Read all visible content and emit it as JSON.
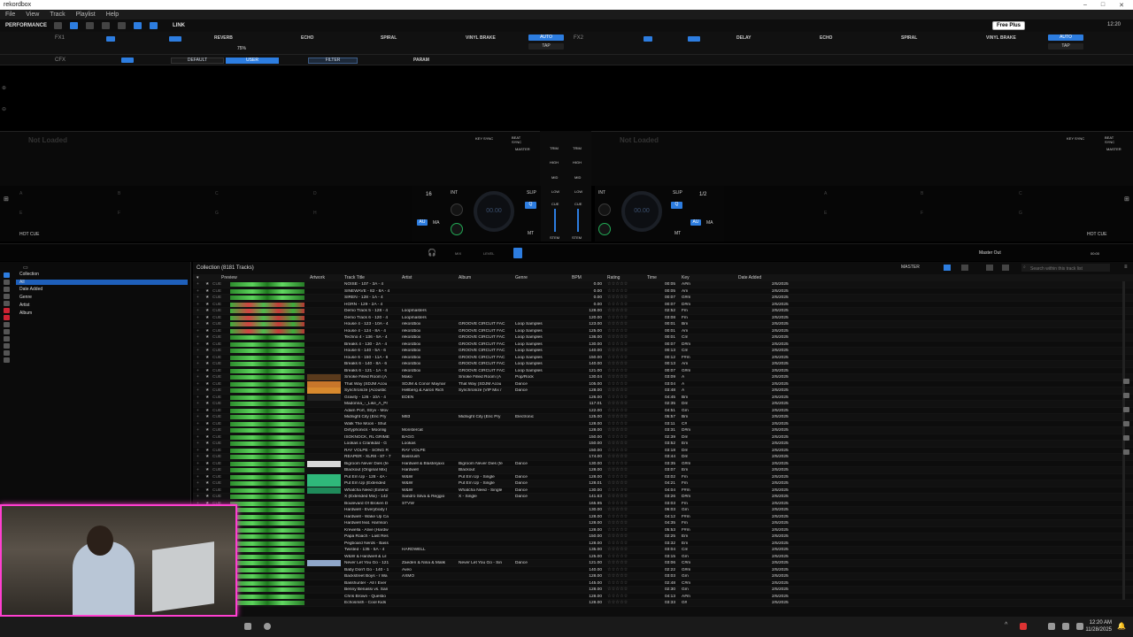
{
  "window": {
    "title": "rekordbox"
  },
  "menu": [
    "File",
    "View",
    "Track",
    "Playlist",
    "Help"
  ],
  "toolbar": {
    "mode": "PERFORMANCE",
    "link": "LINK",
    "free_plus": "Free Plus",
    "clock": "12:20"
  },
  "fx1": {
    "label": "FX1",
    "effects": [
      "REVERB",
      "ECHO",
      "SPIRAL",
      "VINYL BRAKE"
    ],
    "auto": "AUTO",
    "tap": "TAP",
    "value": "75%"
  },
  "fx2": {
    "label": "FX2",
    "effects": [
      "DELAY",
      "ECHO",
      "SPIRAL",
      "VINYL BRAKE"
    ],
    "auto": "AUTO",
    "tap": "TAP"
  },
  "cfx": {
    "label": "CFX",
    "default": "DEFAULT",
    "user": "USER",
    "filter": "FILTER",
    "param": "PARAM"
  },
  "deck1": {
    "status": "Not Loaded",
    "key_sync": "KEY SYNC",
    "beat_sync": "BEAT SYNC",
    "master": "MASTER",
    "bpm": "00.00",
    "beat": "16",
    "int": "INT",
    "slip": "SLIP",
    "q": "Q",
    "au": "AU",
    "ma": "MA",
    "mt": "MT",
    "hot_cue": "HOT CUE"
  },
  "deck2": {
    "status": "Not Loaded",
    "key_sync": "KEY SYNC",
    "beat_sync": "BEAT SYNC",
    "master": "MASTER",
    "bpm": "00.00",
    "beat": "1/2",
    "int": "INT",
    "slip": "SLIP",
    "q": "Q",
    "au": "AU",
    "ma": "MA",
    "mt": "MT",
    "hot_cue": "HOT CUE"
  },
  "mixer": {
    "trim": "TRIM",
    "high": "HIGH",
    "mid": "MID",
    "low": "LOW",
    "cue": "CUE",
    "stem": "STEM"
  },
  "pads": [
    "A",
    "B",
    "C",
    "D",
    "E",
    "F",
    "G",
    "H"
  ],
  "midbar": {
    "mix": "MIX",
    "level": "LEVEL",
    "master_out": "Master Out",
    "time": "00:00"
  },
  "sidebar": {
    "items": [
      "Collection",
      "All",
      "Date Added",
      "Genre",
      "Artist",
      "Album"
    ]
  },
  "browser": {
    "title": "Collection (8181 Tracks)",
    "master": "MASTER",
    "search_placeholder": "Search within this track list",
    "columns": [
      "Preview",
      "Artwork",
      "Track Title",
      "Artist",
      "Album",
      "Genre",
      "BPM",
      "Rating",
      "Time",
      "Key",
      "Date Added"
    ],
    "rows": [
      {
        "title": "NOISE - 107 - 3A - 4",
        "artist": "",
        "album": "",
        "genre": "",
        "bpm": "0.00",
        "time": "00:05",
        "key": "A#m",
        "date": "2/5/2025",
        "wave": "g"
      },
      {
        "title": "SINEWAVE - 82 - 8A - 4",
        "artist": "",
        "album": "",
        "genre": "",
        "bpm": "0.00",
        "time": "00:05",
        "key": "Am",
        "date": "2/5/2025",
        "wave": "g"
      },
      {
        "title": "SIREN - 128 - 1A - 4",
        "artist": "",
        "album": "",
        "genre": "",
        "bpm": "0.00",
        "time": "00:07",
        "key": "G#m",
        "date": "2/5/2025",
        "wave": "g"
      },
      {
        "title": "HORN - 129 - 2A - 4",
        "artist": "",
        "album": "",
        "genre": "",
        "bpm": "0.00",
        "time": "00:07",
        "key": "D#m",
        "date": "2/5/2025",
        "wave": "r"
      },
      {
        "title": "Demo Track 5 - 128 - 4",
        "artist": "Loopmasters",
        "album": "",
        "genre": "",
        "bpm": "128.00",
        "time": "02:52",
        "key": "Fm",
        "date": "2/5/2025",
        "wave": "r"
      },
      {
        "title": "Demo Track 6 - 120 - 4",
        "artist": "Loopmasters",
        "album": "",
        "genre": "",
        "bpm": "120.00",
        "time": "03:08",
        "key": "Fm",
        "date": "2/5/2025",
        "wave": "r"
      },
      {
        "title": "House 4 - 123 - 10A - 4",
        "artist": "rekordbox",
        "album": "GROOVE CIRCUIT FAC",
        "genre": "Loop Samples",
        "bpm": "123.00",
        "time": "00:01",
        "key": "Bm",
        "date": "2/5/2025",
        "wave": "r"
      },
      {
        "title": "House 4 - 124 - 8A - 4",
        "artist": "rekordbox",
        "album": "GROOVE CIRCUIT FAC",
        "genre": "Loop Samples",
        "bpm": "125.00",
        "time": "00:01",
        "key": "Am",
        "date": "2/5/2025",
        "wave": "r"
      },
      {
        "title": "Techno 4 - 136 - 5A - 4",
        "artist": "rekordbox",
        "album": "GROOVE CIRCUIT FAC",
        "genre": "Loop Samples",
        "bpm": "136.00",
        "time": "00:01",
        "key": "Cm",
        "date": "2/5/2025",
        "wave": "g"
      },
      {
        "title": "Breaks 4 - 130 - 2A - 4",
        "artist": "rekordbox",
        "album": "GROOVE CIRCUIT FAC",
        "genre": "Loop Samples",
        "bpm": "130.00",
        "time": "00:07",
        "key": "D#m",
        "date": "2/5/2025",
        "wave": "g"
      },
      {
        "title": "House 6 - 140 - 5A - 6",
        "artist": "rekordbox",
        "album": "GROOVE CIRCUIT FAC",
        "genre": "Loop Samples",
        "bpm": "140.00",
        "time": "00:13",
        "key": "Cm",
        "date": "2/5/2025",
        "wave": "g"
      },
      {
        "title": "House 6 - 150 - 11A - 6",
        "artist": "rekordbox",
        "album": "GROOVE CIRCUIT FAC",
        "genre": "Loop Samples",
        "bpm": "150.00",
        "time": "00:12",
        "key": "F#m",
        "date": "2/5/2025",
        "wave": "g"
      },
      {
        "title": "Breaks 6 - 140 - 8A - 6",
        "artist": "rekordbox",
        "album": "GROOVE CIRCUIT FAC",
        "genre": "Loop Samples",
        "bpm": "140.00",
        "time": "00:13",
        "key": "Am",
        "date": "2/5/2025",
        "wave": "g"
      },
      {
        "title": "Breaks 6 - 121 - 1A - 6",
        "artist": "rekordbox",
        "album": "GROOVE CIRCUIT FAC",
        "genre": "Loop Samples",
        "bpm": "121.00",
        "time": "00:07",
        "key": "G#m",
        "date": "2/5/2025",
        "wave": "g"
      },
      {
        "title": "Smoke Filled Room (A",
        "artist": "Mako",
        "album": "Smoke Filled Room (A",
        "genre": "Pop/Rock",
        "bpm": "130.04",
        "time": "03:09",
        "key": "A",
        "date": "2/5/2025",
        "wave": "g"
      },
      {
        "title": "That Way (SDJM Acou",
        "artist": "SDJM & Conor Maynar",
        "album": "That Way (SDJM Acou",
        "genre": "Dance",
        "bpm": "105.00",
        "time": "03:04",
        "key": "A",
        "date": "2/5/2025",
        "wave": "g"
      },
      {
        "title": "Synchronize (Acoustic",
        "artist": "Hellberg & Aaron Rich",
        "album": "Synchronize (VIP Mix /",
        "genre": "Dance",
        "bpm": "128.00",
        "time": "03:48",
        "key": "A",
        "date": "2/5/2025",
        "wave": "g"
      },
      {
        "title": "Gravity - 126 - 10A - 4",
        "artist": "EDEN",
        "album": "",
        "genre": "",
        "bpm": "126.00",
        "time": "04:45",
        "key": "Bm",
        "date": "2/5/2025",
        "wave": "g"
      },
      {
        "title": "Madonna_-_Like_A_Pr",
        "artist": "",
        "album": "",
        "genre": "",
        "bpm": "117.01",
        "time": "02:35",
        "key": "Dm",
        "date": "2/5/2025",
        "wave": "g"
      },
      {
        "title": "Adam Port, Stryv - Mov",
        "artist": "",
        "album": "",
        "genre": "",
        "bpm": "122.00",
        "time": "04:51",
        "key": "Gm",
        "date": "2/5/2025",
        "wave": "g"
      },
      {
        "title": "Midnight City (Eric Pry",
        "artist": "M83",
        "album": "Midnight City (Eric Pry",
        "genre": "Electronic",
        "bpm": "125.00",
        "time": "05:57",
        "key": "Bm",
        "date": "2/5/2025",
        "wave": "g"
      },
      {
        "title": "Walk The Moon - Shut",
        "artist": "",
        "album": "",
        "genre": "",
        "bpm": "128.00",
        "time": "03:11",
        "key": "C#",
        "date": "2/5/2025",
        "wave": "g"
      },
      {
        "title": "Dirtyphonics - Moonlig",
        "artist": "Monstercat",
        "album": "",
        "genre": "",
        "bpm": "128.00",
        "time": "03:31",
        "key": "D#m",
        "date": "2/5/2025",
        "wave": "g"
      },
      {
        "title": "ISOKNOCK, RL GRIME",
        "artist": "BAGG",
        "album": "",
        "genre": "",
        "bpm": "150.00",
        "time": "02:39",
        "key": "Dm",
        "date": "2/5/2025",
        "wave": "g"
      },
      {
        "title": "Lookas x Crankdat - G",
        "artist": "Lookas",
        "album": "",
        "genre": "",
        "bpm": "150.00",
        "time": "03:52",
        "key": "Em",
        "date": "2/5/2025",
        "wave": "g"
      },
      {
        "title": "RAY VOLPE - SONG R",
        "artist": "RAY VOLPE",
        "album": "",
        "genre": "",
        "bpm": "150.00",
        "time": "03:18",
        "key": "Dm",
        "date": "2/5/2025",
        "wave": "g"
      },
      {
        "title": "REAPER - XLR8 - 87 - 7",
        "artist": "Bassrush",
        "album": "",
        "genre": "",
        "bpm": "174.00",
        "time": "03:44",
        "key": "Dm",
        "date": "2/5/2025",
        "wave": "g"
      },
      {
        "title": "Bigroom Never Dies (fe",
        "artist": "Hardwell & Blasterjaxx",
        "album": "Bigroom Never Dies (fe",
        "genre": "Dance",
        "bpm": "130.00",
        "time": "03:35",
        "key": "G#m",
        "date": "2/5/2025",
        "wave": "g"
      },
      {
        "title": "Blackout (Original Mix)",
        "artist": "Hardwell",
        "album": "Blackout",
        "genre": "",
        "bpm": "128.00",
        "time": "03:07",
        "key": "Em",
        "date": "2/5/2025",
        "wave": "g"
      },
      {
        "title": "Put Em Up - 128 - 4A -",
        "artist": "W&W",
        "album": "Put Em Up - Single",
        "genre": "Dance",
        "bpm": "128.00",
        "time": "03:02",
        "key": "Fm",
        "date": "2/5/2025",
        "wave": "g"
      },
      {
        "title": "Put Em Up (Extended",
        "artist": "W&W",
        "album": "Put Em Up - Single",
        "genre": "Dance",
        "bpm": "128.01",
        "time": "04:21",
        "key": "Fm",
        "date": "2/5/2025",
        "wave": "g"
      },
      {
        "title": "Whatcha Need (Extend",
        "artist": "W&W",
        "album": "Whatcha Need - Single",
        "genre": "Dance",
        "bpm": "130.00",
        "time": "04:04",
        "key": "F#m",
        "date": "2/5/2025",
        "wave": "g"
      },
      {
        "title": "X (Extended Mix) - 142",
        "artist": "Sandro Silva & Reggio",
        "album": "X - Single",
        "genre": "Dance",
        "bpm": "141.63",
        "time": "03:26",
        "key": "D#m",
        "date": "2/5/2025",
        "wave": "g"
      },
      {
        "title": "Boulevard Of Broken D",
        "artist": "STVW",
        "album": "",
        "genre": "",
        "bpm": "165.95",
        "time": "03:03",
        "key": "Fm",
        "date": "2/5/2025",
        "wave": "g"
      },
      {
        "title": "Hardwell - Everybody I",
        "artist": "",
        "album": "",
        "genre": "",
        "bpm": "130.00",
        "time": "06:03",
        "key": "Gm",
        "date": "2/5/2025",
        "wave": "g"
      },
      {
        "title": "Hardwell - Wake Up Ca",
        "artist": "",
        "album": "",
        "genre": "",
        "bpm": "128.00",
        "time": "04:12",
        "key": "F#m",
        "date": "2/5/2025",
        "wave": "g"
      },
      {
        "title": "Hardwell feat. Harrison",
        "artist": "",
        "album": "",
        "genre": "",
        "bpm": "128.00",
        "time": "04:35",
        "key": "Fm",
        "date": "2/5/2025",
        "wave": "g"
      },
      {
        "title": "Krewella - Alive (Hardw",
        "artist": "",
        "album": "",
        "genre": "",
        "bpm": "128.00",
        "time": "05:53",
        "key": "F#m",
        "date": "2/5/2025",
        "wave": "g"
      },
      {
        "title": "Papa Roach - Last Res",
        "artist": "",
        "album": "",
        "genre": "",
        "bpm": "150.00",
        "time": "02:25",
        "key": "Em",
        "date": "2/5/2025",
        "wave": "g"
      },
      {
        "title": "Pegboard Nerds - Bass",
        "artist": "",
        "album": "",
        "genre": "",
        "bpm": "128.00",
        "time": "03:32",
        "key": "Em",
        "date": "2/5/2025",
        "wave": "g"
      },
      {
        "title": "Twisted - 135 - 5A - 4",
        "artist": "HARDWELL",
        "album": "",
        "genre": "",
        "bpm": "135.00",
        "time": "03:04",
        "key": "Cm",
        "date": "2/5/2025",
        "wave": "g"
      },
      {
        "title": "W&W & Hardwell & Lil",
        "artist": "",
        "album": "",
        "genre": "",
        "bpm": "125.00",
        "time": "03:15",
        "key": "Gm",
        "date": "2/5/2025",
        "wave": "g"
      },
      {
        "title": "Never Let You Go - 121",
        "artist": "Zaeden & Nina & Malik",
        "album": "Never Let You Go - Sin",
        "genre": "Dance",
        "bpm": "121.00",
        "time": "03:06",
        "key": "C#m",
        "date": "2/5/2025",
        "wave": "g"
      },
      {
        "title": "Baby Don't Go - 140 - 1",
        "artist": "Aveo",
        "album": "",
        "genre": "",
        "bpm": "140.00",
        "time": "02:22",
        "key": "G#m",
        "date": "2/5/2025",
        "wave": "g"
      },
      {
        "title": "Backstreet Boys - I Wa",
        "artist": "AXMO",
        "album": "",
        "genre": "",
        "bpm": "128.00",
        "time": "03:03",
        "key": "Gm",
        "date": "2/5/2025",
        "wave": "g"
      },
      {
        "title": "Basshunter - All I Ever",
        "artist": "",
        "album": "",
        "genre": "",
        "bpm": "145.00",
        "time": "02:48",
        "key": "C#m",
        "date": "2/5/2025",
        "wave": "g"
      },
      {
        "title": "Benny Benassi vs. San",
        "artist": "",
        "album": "",
        "genre": "",
        "bpm": "128.00",
        "time": "02:30",
        "key": "Gm",
        "date": "2/5/2025",
        "wave": "g"
      },
      {
        "title": "Chris Brown - Questio",
        "artist": "",
        "album": "",
        "genre": "",
        "bpm": "128.00",
        "time": "04:13",
        "key": "A#m",
        "date": "2/5/2025",
        "wave": "g"
      },
      {
        "title": "Echosmith - Cool Kids",
        "artist": "",
        "album": "",
        "genre": "",
        "bpm": "128.00",
        "time": "03:33",
        "key": "G#",
        "date": "2/5/2025",
        "wave": "g"
      }
    ]
  },
  "taskbar": {
    "time": "12:20 AM",
    "date": "11/28/2025"
  },
  "colors": {
    "accent": "#2d7de0",
    "webcam_border": "#ff3fd0"
  }
}
